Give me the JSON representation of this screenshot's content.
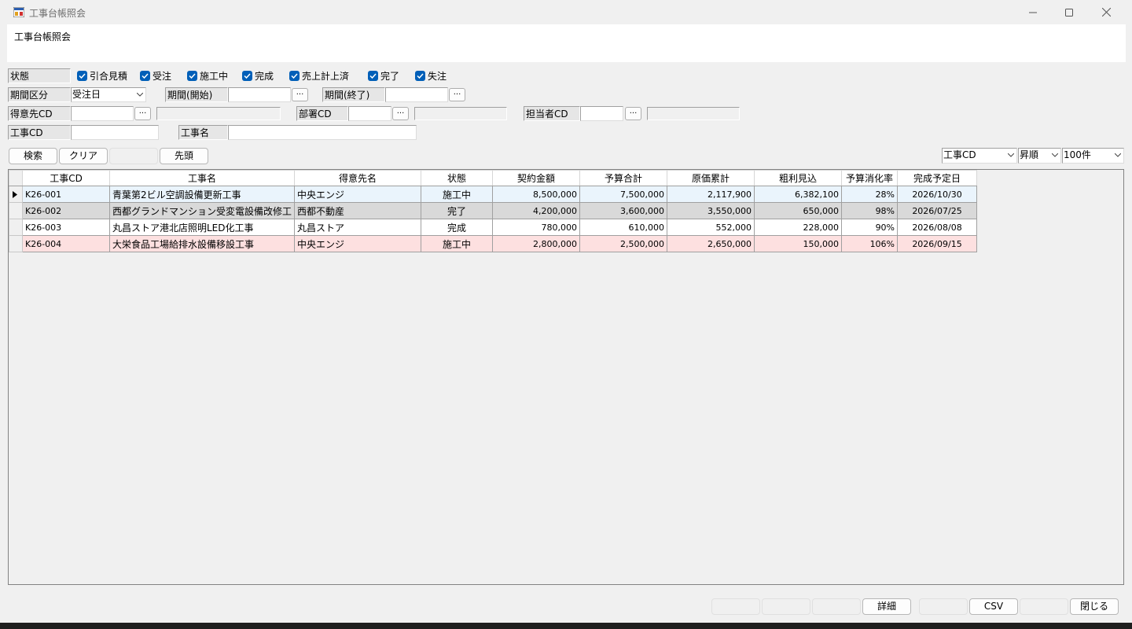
{
  "window": {
    "title": "工事台帳照会"
  },
  "header": {
    "title": "工事台帳照会"
  },
  "filters": {
    "status_label": "状態",
    "status_checks": [
      {
        "label": "引合見積",
        "checked": true
      },
      {
        "label": "受注",
        "checked": true
      },
      {
        "label": "施工中",
        "checked": true
      },
      {
        "label": "完成",
        "checked": true
      },
      {
        "label": "売上計上済",
        "checked": true
      },
      {
        "label": "完了",
        "checked": true
      },
      {
        "label": "失注",
        "checked": true
      }
    ],
    "period_type_label": "期間区分",
    "period_type_value": "受注日",
    "period_start_label": "期間(開始)",
    "period_end_label": "期間(終了)",
    "customer_cd_label": "得意先CD",
    "dept_cd_label": "部署CD",
    "staff_cd_label": "担当者CD",
    "job_cd_label": "工事CD",
    "job_name_label": "工事名",
    "browse_label": "..."
  },
  "toolbar": {
    "search": "検索",
    "clear": "クリア",
    "top": "先頭",
    "sort_key": "工事CD",
    "sort_order": "昇順",
    "limit": "100件"
  },
  "grid": {
    "columns": [
      "工事CD",
      "工事名",
      "得意先名",
      "状態",
      "契約金額",
      "予算合計",
      "原価累計",
      "粗利見込",
      "予算消化率",
      "完成予定日"
    ],
    "rows": [
      [
        "K26-001",
        "青葉第2ビル空調設備更新工事",
        "中央エンジ",
        "施工中",
        "8,500,000",
        "7,500,000",
        "2,117,900",
        "6,382,100",
        "28%",
        "2026/10/30"
      ],
      [
        "K26-002",
        "西都グランドマンション受変電設備改修工",
        "西都不動産",
        "完了",
        "4,200,000",
        "3,600,000",
        "3,550,000",
        "650,000",
        "98%",
        "2026/07/25"
      ],
      [
        "K26-003",
        "丸昌ストア港北店照明LED化工事",
        "丸昌ストア",
        "完成",
        "780,000",
        "610,000",
        "552,000",
        "228,000",
        "90%",
        "2026/08/08"
      ],
      [
        "K26-004",
        "大栄食品工場給排水設備移設工事",
        "中央エンジ",
        "施工中",
        "2,800,000",
        "2,500,000",
        "2,650,000",
        "150,000",
        "106%",
        "2026/09/15"
      ]
    ]
  },
  "footer": {
    "detail": "詳細",
    "csv": "CSV",
    "close": "閉じる"
  }
}
